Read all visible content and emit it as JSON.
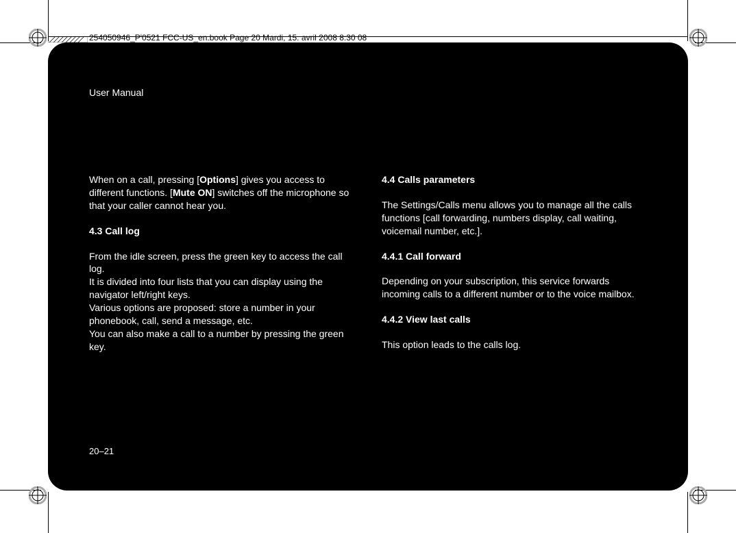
{
  "header_strip_text": "254050946_P'0521 FCC-US_en.book Page 20 Mardi, 15. avril 2008 8:30 08",
  "page": {
    "title": "User Manual",
    "page_number": "20–21",
    "left": {
      "intro_pre": "When on a call, pressing [",
      "intro_bold1": "Options",
      "intro_mid": "] gives you access to different functions. [",
      "intro_bold2": "Mute ON",
      "intro_post": "] switches off the microphone so that your caller cannot hear you.",
      "h43": "4.3 Call log",
      "p1": "From the idle screen, press the green key to access the call log.",
      "p2": "It is divided into four lists that you can display using the navigator left/right keys.",
      "p3": "Various options are proposed: store a number in your phonebook, call, send a message, etc.",
      "p4": "You can also make a call to a number by pressing the green key."
    },
    "right": {
      "h44": "4.4 Calls parameters",
      "p1": "The Settings/Calls menu allows you to manage all the calls functions [call forwarding, numbers display, call waiting, voicemail number, etc.].",
      "h441": "4.4.1 Call forward",
      "p2": "Depending on your subscription, this service forwards incoming calls to a different number or to the voice mailbox.",
      "h442": "4.4.2 View last calls",
      "p3": "This option leads to the calls log."
    }
  }
}
